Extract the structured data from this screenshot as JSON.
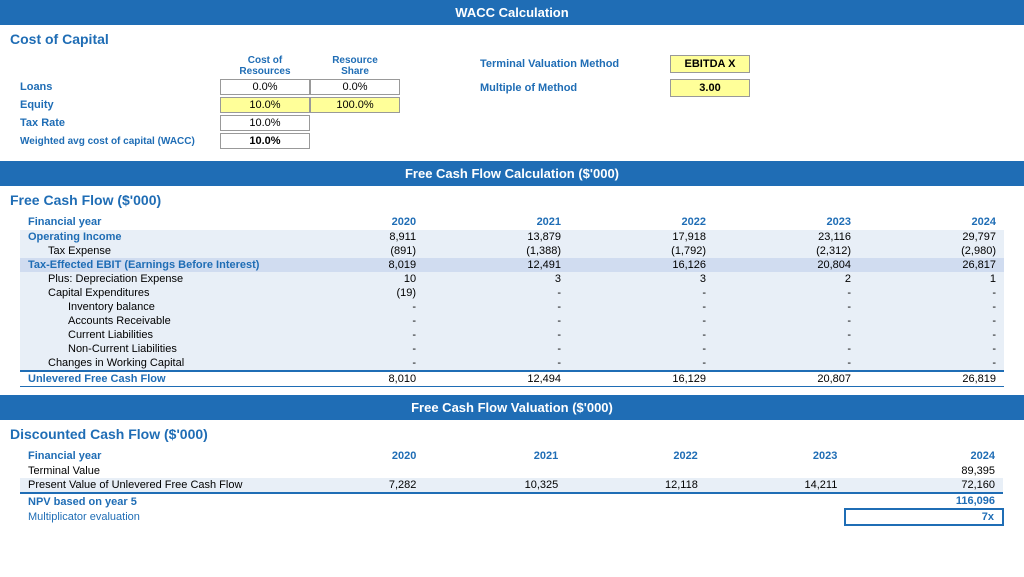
{
  "wacc_header": "WACC Calculation",
  "cost_of_capital_title": "Cost of Capital",
  "col_headers": [
    "Cost of Resources",
    "Resource Share"
  ],
  "wacc_rows": [
    {
      "label": "Loans",
      "cost": "0.0%",
      "share": "0.0%",
      "cost_style": "white",
      "share_style": "white"
    },
    {
      "label": "Equity",
      "cost": "10.0%",
      "share": "100.0%",
      "cost_style": "yellow",
      "share_style": "yellow"
    },
    {
      "label": "Tax Rate",
      "cost": "10.0%",
      "share": "",
      "cost_style": "white",
      "share_style": ""
    },
    {
      "label": "Weighted avg cost of capital (WACC)",
      "cost": "10.0%",
      "share": "",
      "cost_style": "bold-white",
      "share_style": ""
    }
  ],
  "terminal_method_label": "Terminal Valuation Method",
  "multiple_method_label": "Multiple of Method",
  "terminal_method_value": "EBITDA X",
  "multiple_method_value": "3.00",
  "fcf_header": "Free Cash Flow Calculation ($'000)",
  "fcf_title": "Free Cash Flow ($'000)",
  "fcf_year_label": "Financial year",
  "fcf_years": [
    "2020",
    "2021",
    "2022",
    "2023",
    "2024"
  ],
  "fcf_rows": [
    {
      "label": "Operating Income",
      "indent": 0,
      "bold": true,
      "style": "light",
      "values": [
        "8,911",
        "13,879",
        "17,918",
        "23,116",
        "29,797"
      ]
    },
    {
      "label": "Tax Expense",
      "indent": 1,
      "bold": false,
      "style": "light",
      "values": [
        "(891)",
        "(1,388)",
        "(1,792)",
        "(2,312)",
        "(2,980)"
      ]
    },
    {
      "label": "Tax-Effected EBIT (Earnings Before Interest)",
      "indent": 0,
      "bold": true,
      "style": "medium",
      "values": [
        "8,019",
        "12,491",
        "16,126",
        "20,804",
        "26,817"
      ]
    },
    {
      "label": "Plus: Depreciation Expense",
      "indent": 1,
      "bold": false,
      "style": "light",
      "values": [
        "10",
        "3",
        "3",
        "2",
        "1"
      ]
    },
    {
      "label": "Capital Expenditures",
      "indent": 1,
      "bold": false,
      "style": "light",
      "values": [
        "(19)",
        "-",
        "-",
        "-",
        "-"
      ]
    },
    {
      "label": "Inventory balance",
      "indent": 2,
      "bold": false,
      "style": "light",
      "values": [
        "-",
        "-",
        "-",
        "-",
        "-"
      ]
    },
    {
      "label": "Accounts Receivable",
      "indent": 2,
      "bold": false,
      "style": "light",
      "values": [
        "-",
        "-",
        "-",
        "-",
        "-"
      ]
    },
    {
      "label": "Current Liabilities",
      "indent": 2,
      "bold": false,
      "style": "light",
      "values": [
        "-",
        "-",
        "-",
        "-",
        "-"
      ]
    },
    {
      "label": "Non-Current Liabilities",
      "indent": 2,
      "bold": false,
      "style": "light",
      "values": [
        "-",
        "-",
        "-",
        "-",
        "-"
      ]
    },
    {
      "label": "Changes in Working Capital",
      "indent": 1,
      "bold": false,
      "style": "light",
      "values": [
        "-",
        "-",
        "-",
        "-",
        "-"
      ]
    },
    {
      "label": "Unlevered Free Cash Flow",
      "indent": 0,
      "bold": true,
      "style": "unlevered",
      "values": [
        "8,010",
        "12,494",
        "16,129",
        "20,807",
        "26,819"
      ]
    }
  ],
  "dcf_header": "Free Cash Flow Valuation ($'000)",
  "dcf_title": "Discounted Cash Flow ($'000)",
  "dcf_year_label": "Financial year",
  "dcf_years": [
    "2020",
    "2021",
    "2022",
    "2023",
    "2024"
  ],
  "dcf_rows": [
    {
      "label": "Terminal Value",
      "indent": 0,
      "bold": false,
      "style": "white",
      "values": [
        "",
        "",
        "",
        "",
        "89,395"
      ]
    },
    {
      "label": "Present Value of Unlevered Free Cash Flow",
      "indent": 0,
      "bold": false,
      "style": "light",
      "values": [
        "7,282",
        "10,325",
        "12,118",
        "14,211",
        "72,160"
      ]
    }
  ],
  "npv_label": "NPV based on year 5",
  "npv_value": "116,096",
  "mult_label": "Multiplicator evaluation",
  "mult_value": "7x"
}
